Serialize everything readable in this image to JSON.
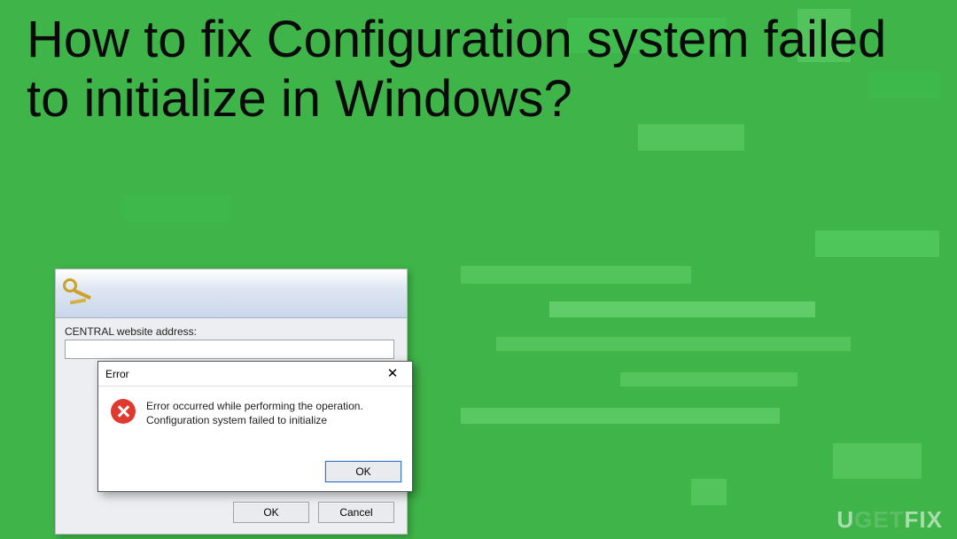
{
  "headline": "How to fix Configuration system failed to initialize in Windows?",
  "parent_dialog": {
    "label_address": "CENTRAL website address:",
    "input_value": "",
    "ok_label": "OK",
    "cancel_label": "Cancel"
  },
  "error_dialog": {
    "title": "Error",
    "line1": "Error occurred while performing the operation.",
    "line2": "Configuration system failed to initialize",
    "ok_label": "OK"
  },
  "watermark": {
    "part1": "U",
    "part2": "GET",
    "part3": "FIX"
  }
}
